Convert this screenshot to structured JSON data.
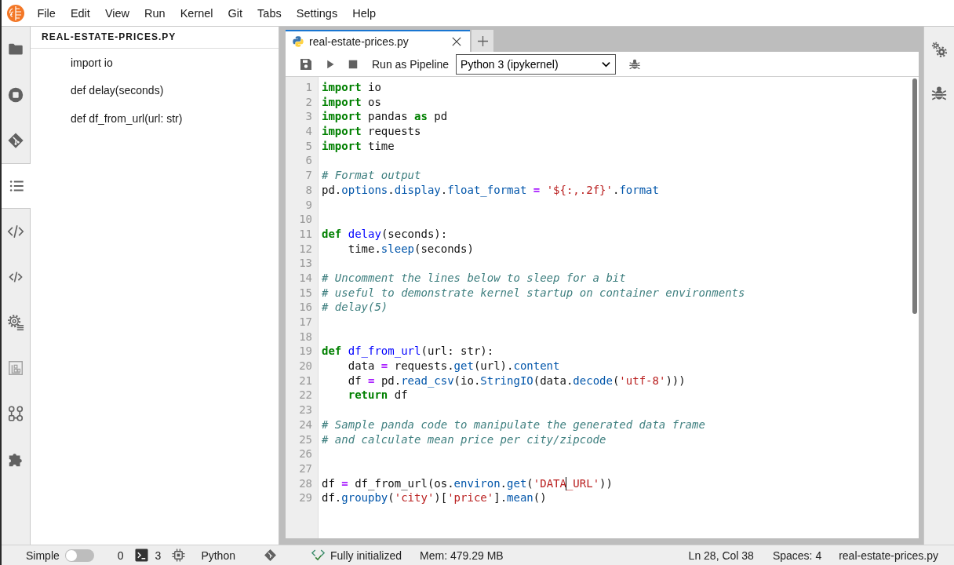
{
  "menu_bar": {
    "items": [
      "File",
      "Edit",
      "View",
      "Run",
      "Kernel",
      "Git",
      "Tabs",
      "Settings",
      "Help"
    ]
  },
  "activity_bar": [
    {
      "kind": "folder",
      "selected": false
    },
    {
      "kind": "running",
      "selected": false
    },
    {
      "kind": "git",
      "selected": false
    },
    {
      "kind": "toc",
      "selected": true
    },
    {
      "kind": "code",
      "selected": false
    },
    {
      "kind": "code-small",
      "selected": false
    },
    {
      "kind": "settings-list",
      "selected": false
    },
    {
      "kind": "property",
      "selected": false
    },
    {
      "kind": "pipeline",
      "selected": false
    },
    {
      "kind": "extension",
      "selected": false
    }
  ],
  "table_of_contents": {
    "title": "REAL-ESTATE-PRICES.PY",
    "items": [
      "import io",
      "def delay(seconds)",
      "def df_from_url(url: str)"
    ]
  },
  "editor": {
    "tabs": [
      {
        "label": "real-estate-prices.py",
        "selected": true
      }
    ],
    "toolbar": {
      "pipeline_label": "Run as Pipeline",
      "kernel": "Python 3 (ipykernel)"
    },
    "lines": [
      {
        "number": "1",
        "tokens": [
          {
            "text": "import",
            "kind": "keyword"
          },
          {
            "text": " io",
            "kind": "plain"
          }
        ]
      },
      {
        "number": "2",
        "tokens": [
          {
            "text": "import",
            "kind": "keyword"
          },
          {
            "text": " os",
            "kind": "plain"
          }
        ]
      },
      {
        "number": "3",
        "tokens": [
          {
            "text": "import",
            "kind": "keyword"
          },
          {
            "text": " pandas ",
            "kind": "plain"
          },
          {
            "text": "as",
            "kind": "keyword"
          },
          {
            "text": " pd",
            "kind": "plain"
          }
        ]
      },
      {
        "number": "4",
        "tokens": [
          {
            "text": "import",
            "kind": "keyword"
          },
          {
            "text": " requests",
            "kind": "plain"
          }
        ]
      },
      {
        "number": "5",
        "tokens": [
          {
            "text": "import",
            "kind": "keyword"
          },
          {
            "text": " time",
            "kind": "plain"
          }
        ]
      },
      {
        "number": "6"
      },
      {
        "number": "7",
        "tokens": [
          {
            "text": "# Format output",
            "kind": "comment"
          }
        ]
      },
      {
        "number": "8",
        "tokens": [
          {
            "text": "pd.",
            "kind": "plain"
          },
          {
            "text": "options",
            "kind": "property"
          },
          {
            "text": ".",
            "kind": "plain"
          },
          {
            "text": "display",
            "kind": "property"
          },
          {
            "text": ".",
            "kind": "plain"
          },
          {
            "text": "float_format",
            "kind": "property"
          },
          {
            "text": " = ",
            "kind": "operator"
          },
          {
            "text": "'${:,.2f}'",
            "kind": "string"
          },
          {
            "text": ".",
            "kind": "plain"
          },
          {
            "text": "format",
            "kind": "property"
          }
        ]
      },
      {
        "number": "9"
      },
      {
        "number": "10"
      },
      {
        "number": "11",
        "tokens": [
          {
            "text": "def",
            "kind": "keyword"
          },
          {
            "text": " delay",
            "kind": "definition"
          },
          {
            "text": "(seconds):",
            "kind": "plain"
          }
        ]
      },
      {
        "number": "12",
        "tokens": [
          {
            "text": "    time.",
            "kind": "plain"
          },
          {
            "text": "sleep",
            "kind": "property"
          },
          {
            "text": "(seconds)",
            "kind": "plain"
          }
        ]
      },
      {
        "number": "13"
      },
      {
        "number": "14",
        "tokens": [
          {
            "text": "# Uncomment the lines below to sleep for a bit",
            "kind": "comment"
          }
        ]
      },
      {
        "number": "15",
        "tokens": [
          {
            "text": "# useful to demonstrate kernel startup on container environments",
            "kind": "comment"
          }
        ]
      },
      {
        "number": "16",
        "tokens": [
          {
            "text": "# delay(5)",
            "kind": "comment"
          }
        ]
      },
      {
        "number": "17"
      },
      {
        "number": "18"
      },
      {
        "number": "19",
        "tokens": [
          {
            "text": "def",
            "kind": "keyword"
          },
          {
            "text": " df_from_url",
            "kind": "definition"
          },
          {
            "text": "(url: str):",
            "kind": "plain"
          }
        ]
      },
      {
        "number": "20",
        "tokens": [
          {
            "text": "    data ",
            "kind": "plain"
          },
          {
            "text": "=",
            "kind": "operator"
          },
          {
            "text": " requests.",
            "kind": "plain"
          },
          {
            "text": "get",
            "kind": "property"
          },
          {
            "text": "(url).",
            "kind": "plain"
          },
          {
            "text": "content",
            "kind": "property"
          }
        ]
      },
      {
        "number": "21",
        "tokens": [
          {
            "text": "    df ",
            "kind": "plain"
          },
          {
            "text": "=",
            "kind": "operator"
          },
          {
            "text": " pd.",
            "kind": "plain"
          },
          {
            "text": "read_csv",
            "kind": "property"
          },
          {
            "text": "(io.",
            "kind": "plain"
          },
          {
            "text": "StringIO",
            "kind": "property"
          },
          {
            "text": "(data.",
            "kind": "plain"
          },
          {
            "text": "decode",
            "kind": "property"
          },
          {
            "text": "(",
            "kind": "plain"
          },
          {
            "text": "'utf-8'",
            "kind": "string"
          },
          {
            "text": ")))",
            "kind": "plain"
          }
        ]
      },
      {
        "number": "22",
        "tokens": [
          {
            "text": "    return",
            "kind": "keyword"
          },
          {
            "text": " df",
            "kind": "plain"
          }
        ]
      },
      {
        "number": "23"
      },
      {
        "number": "24",
        "tokens": [
          {
            "text": "# Sample panda code to manipulate the generated data frame",
            "kind": "comment"
          }
        ]
      },
      {
        "number": "25",
        "tokens": [
          {
            "text": "# and calculate mean price per city/zipcode",
            "kind": "comment"
          }
        ]
      },
      {
        "number": "26"
      },
      {
        "number": "27"
      },
      {
        "number": "28",
        "tokens": [
          {
            "text": "df ",
            "kind": "plain"
          },
          {
            "text": "=",
            "kind": "operator"
          },
          {
            "text": " df_from_url(os.",
            "kind": "plain"
          },
          {
            "text": "environ",
            "kind": "property"
          },
          {
            "text": ".",
            "kind": "plain"
          },
          {
            "text": "get",
            "kind": "property"
          },
          {
            "text": "(",
            "kind": "plain"
          },
          {
            "text": "'DATA",
            "kind": "string"
          },
          {
            "text": "_URL'",
            "kind": "string",
            "cursor_before": true
          },
          {
            "text": "))",
            "kind": "plain"
          }
        ]
      },
      {
        "number": "29",
        "tokens": [
          {
            "text": "df.",
            "kind": "plain"
          },
          {
            "text": "groupby",
            "kind": "property"
          },
          {
            "text": "(",
            "kind": "plain"
          },
          {
            "text": "'city'",
            "kind": "string"
          },
          {
            "text": ")[",
            "kind": "plain"
          },
          {
            "text": "'price'",
            "kind": "string"
          },
          {
            "text": "].",
            "kind": "plain"
          },
          {
            "text": "mean",
            "kind": "property"
          },
          {
            "text": "()",
            "kind": "plain"
          }
        ]
      }
    ]
  },
  "status_bar": {
    "mode_label": "Simple",
    "mode_toggle": {
      "on": false
    },
    "terminals": "0",
    "kernels": "3",
    "kernel_name": "Python",
    "kernel_status": "Fully initialized",
    "memory": "Mem: 479.29 MB",
    "cursor_position": "Ln 28, Col 38",
    "indentation": "Spaces: 4",
    "file_name": "real-estate-prices.py"
  }
}
